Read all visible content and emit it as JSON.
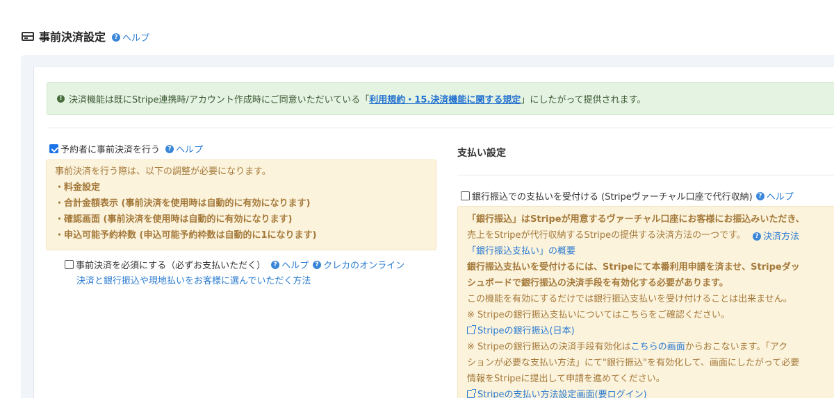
{
  "header": {
    "title": "事前決済設定",
    "help_label": "ヘルプ",
    "icon": "credit-card-icon"
  },
  "alert": {
    "text_before": "決済機能は既にStripe連携時/アカウント作成時にご同意いただいている「",
    "link_text": "利用規約・15.決済機能に関する規定",
    "text_after": "」にしたがって提供されます。",
    "icon": "exclamation-circle-icon"
  },
  "left": {
    "prepay_checkbox_label": "予約者に事前決済を行う",
    "prepay_checked": true,
    "help_label": "ヘルプ",
    "notice": {
      "intro": "事前決済を行う際は、以下の調整が必要になります。",
      "items": [
        "・料金設定",
        "・合計金額表示 (事前決済を使用時は自動的に有効になります)",
        "・確認画面 (事前決済を使用時は自動的に有効になります)",
        "・申込可能予約枠数 (申込可能予約枠数は自動的に1になります)"
      ]
    },
    "required_checkbox_label": "事前決済を必須にする（必ずお支払いただく）",
    "required_checked": false,
    "required_help_label": "ヘルプ",
    "online_link_label": "クレカのオンライン",
    "online_link_cont": "決済と銀行振込や現地払いをお客様に選んでいただく方法"
  },
  "right": {
    "section_title": "支払い設定",
    "bank_checkbox_label": "銀行振込での支払いを受付ける (Stripeヴァーチャル口座で代行収納)",
    "bank_checked": false,
    "help_label": "ヘルプ",
    "info": {
      "l1": "「銀行振込」はStripeが用意するヴァーチャル口座にお客様にお振込みいただき、",
      "l2": "売上をStripeが代行収納するStripeの提供する決済方法の一つです。",
      "method_link": "決済方法",
      "l3_link": "「銀行振込支払い」の概要",
      "l4": "銀行振込支払いを受付けるには、Stripeにて本番利用申請を済ませ、Stripeダッ",
      "l5": "シュボードで銀行振込の決済手段を有効化する必要があります。",
      "l6": "この機能を有効にするだけでは銀行振込支払いを受け付けることは出来ません。",
      "l7": "※ Stripeの銀行振込支払いについてはこちらをご確認ください。",
      "l8_link": "Stripeの銀行振込(日本)",
      "l9_a": "※ Stripeの銀行振込の決済手段有効化は",
      "l9_link": "こちらの画面",
      "l9_b": "からおこないます。「アク",
      "l10": "ションが必要な支払い方法」にて\"銀行振込\"を有効化して、画面にしたがって必要",
      "l11": "情報をStripeに提出して申請を進めてください。",
      "l12_link": "Stripeの支払い方法設定画面(要ログイン)"
    }
  },
  "colors": {
    "link": "#2a7bd1",
    "alert_bg": "#e5f3e2",
    "warning_bg": "#fcf3dc",
    "warning_text": "#a4793a",
    "checkbox_checked": "#1a73e8"
  }
}
